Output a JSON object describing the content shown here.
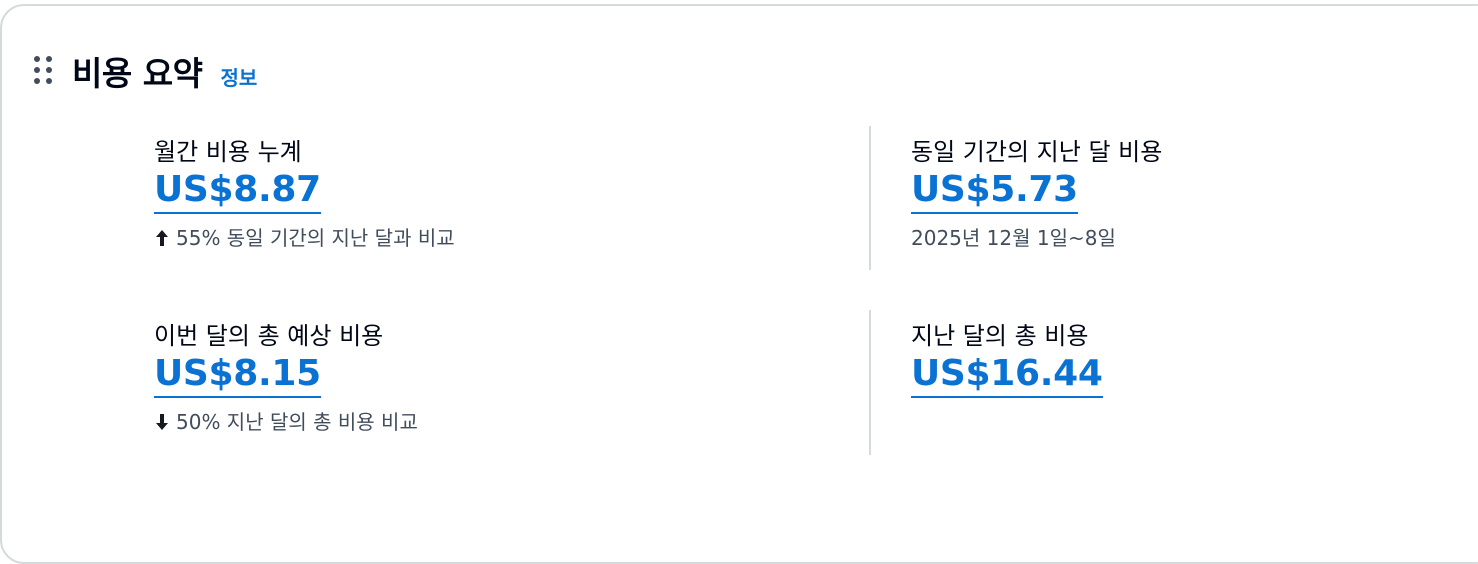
{
  "header": {
    "title": "비용 요약",
    "info_link": "정보"
  },
  "metrics": [
    {
      "label": "월간 비용 누계",
      "value": "US$8.87",
      "trend": "up",
      "sub": "55% 동일 기간의 지난 달과 비교"
    },
    {
      "label": "동일 기간의 지난 달 비용",
      "value": "US$5.73",
      "sub": "2025년 12월 1일~8일"
    },
    {
      "label": "이번 달의 총 예상 비용",
      "value": "US$8.15",
      "trend": "down",
      "sub": "50% 지난 달의 총 비용 비교"
    },
    {
      "label": "지난 달의 총 비용",
      "value": "US$16.44"
    }
  ],
  "icons": {
    "drag_handle": "drag-handle-icon",
    "trend_up": "arrow-up-icon",
    "trend_down": "arrow-down-icon"
  },
  "colors": {
    "link": "#0972d3",
    "text": "#000716",
    "secondary_text": "#414d5c",
    "divider": "#d5dbdb"
  }
}
